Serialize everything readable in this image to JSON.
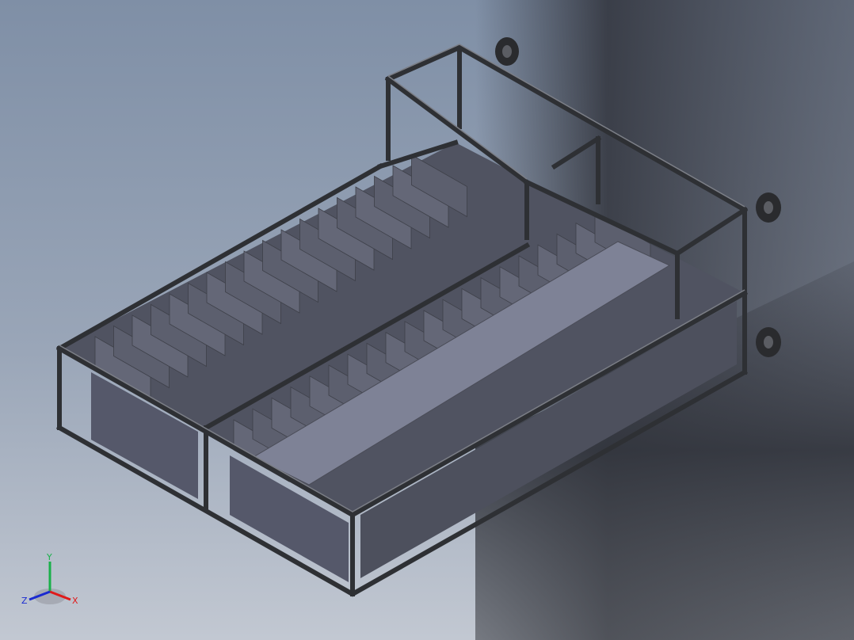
{
  "viewport": {
    "background_top": "#7f8fa6",
    "background_bottom": "#c2c8d2"
  },
  "model": {
    "frame_color": "#3a3c41",
    "panel_color": "#5e6170",
    "cover_color": "#7d8194",
    "caster_color": "#2a2b2e"
  },
  "triad": {
    "x_label": "X",
    "y_label": "Y",
    "z_label": "Z",
    "x_color": "#e01a1a",
    "y_color": "#1ab04a",
    "z_color": "#1a2ad0"
  }
}
